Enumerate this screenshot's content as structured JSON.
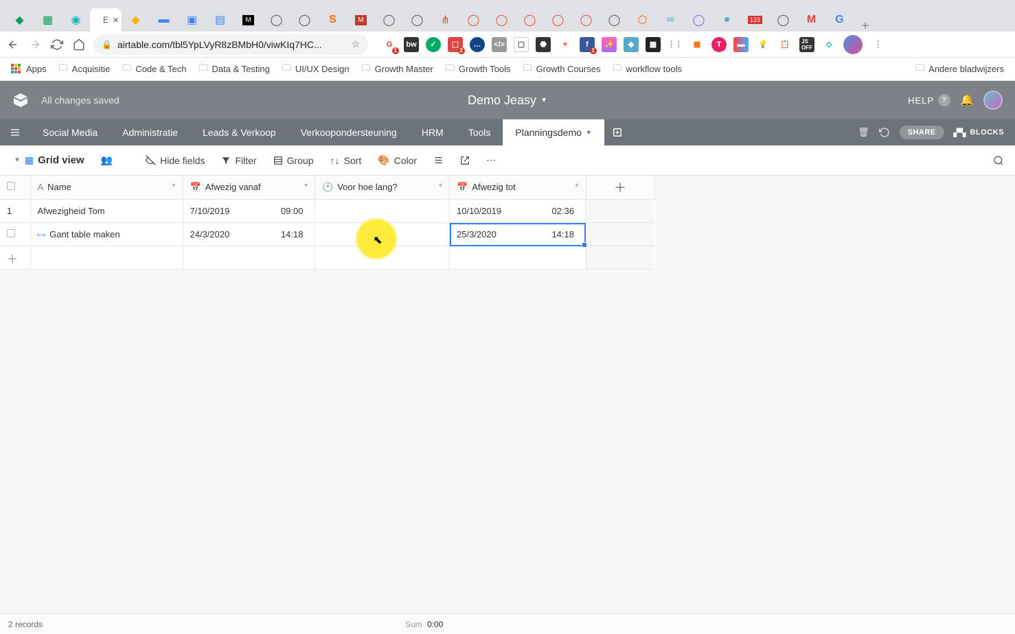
{
  "browser": {
    "url": "airtable.com/tbl5YpLVyR8zBMbH0/viwKIq7HC...",
    "bookmarks": {
      "apps": "Apps",
      "folders": [
        "Acquisitie",
        "Code & Tech",
        "Data & Testing",
        "UI/UX Design",
        "Growth Master",
        "Growth Tools",
        "Growth Courses",
        "workflow tools"
      ],
      "overflow": "Andere bladwijzers"
    }
  },
  "airtable": {
    "save_status": "All changes saved",
    "base_title": "Demo Jeasy",
    "header": {
      "help": "HELP",
      "share": "SHARE",
      "blocks": "BLOCKS"
    },
    "tabs": [
      "Social Media",
      "Administratie",
      "Leads & Verkoop",
      "Verkoopondersteuning",
      "HRM",
      "Tools",
      "Planningsdemo"
    ],
    "active_tab_index": 6,
    "view": {
      "name": "Grid view",
      "hide_fields": "Hide fields",
      "filter": "Filter",
      "group": "Group",
      "sort": "Sort",
      "color": "Color"
    },
    "columns": {
      "name": "Name",
      "afwezig_vanaf": "Afwezig vanaf",
      "voor_hoe_lang": "Voor hoe lang?",
      "afwezig_tot": "Afwezig tot"
    },
    "rows": [
      {
        "num": "1",
        "name": "Afwezigheid Tom",
        "from_date": "7/10/2019",
        "from_time": "09:00",
        "dur": "",
        "to_date": "10/10/2019",
        "to_time": "02:36"
      },
      {
        "num": "",
        "name": "Gant table maken",
        "from_date": "24/3/2020",
        "from_time": "14:18",
        "dur": "",
        "to_date": "25/3/2020",
        "to_time": "14:18"
      }
    ],
    "status": {
      "records": "2 records",
      "sum_label": "Sum",
      "sum_value": "0:00"
    }
  }
}
